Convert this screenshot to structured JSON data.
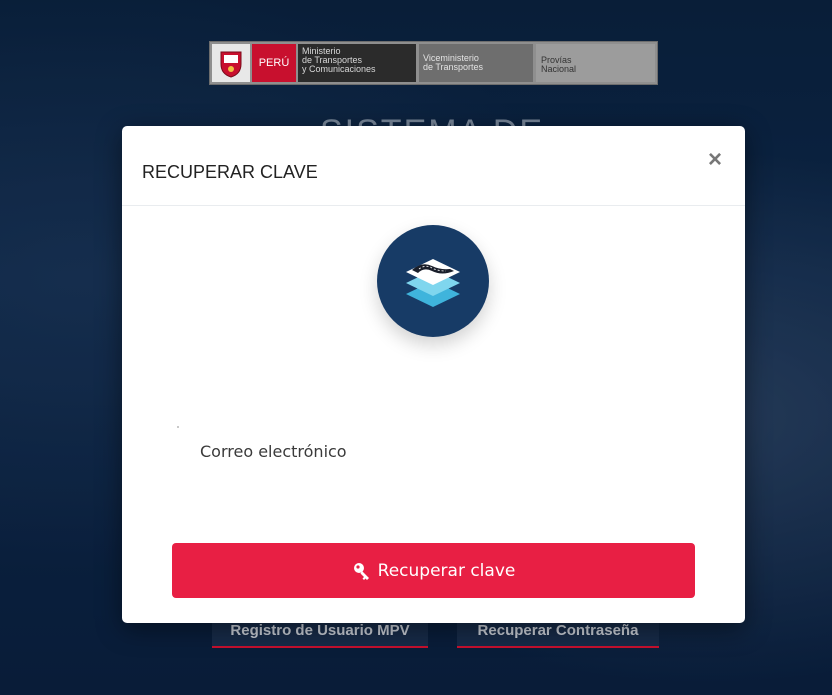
{
  "banner": {
    "country": "PERÚ",
    "ministry": [
      "Ministerio",
      "de Transportes",
      "y Comunicaciones"
    ],
    "vice": [
      "Viceministerio",
      "de Transportes"
    ],
    "provias": [
      "Provías",
      "Nacional"
    ]
  },
  "background": {
    "title_fragment": "SISTEMA DE",
    "register_button": "Registro de Usuario MPV",
    "recover_button": "Recuperar Contraseña"
  },
  "modal": {
    "title": "RECUPERAR CLAVE",
    "close_icon": "×",
    "email_placeholder": "Correo electrónico",
    "submit_label": "Recuperar clave"
  },
  "colors": {
    "accent": "#e81f44",
    "navy": "#173b66",
    "logo_cyan": "#4ec5e5"
  }
}
